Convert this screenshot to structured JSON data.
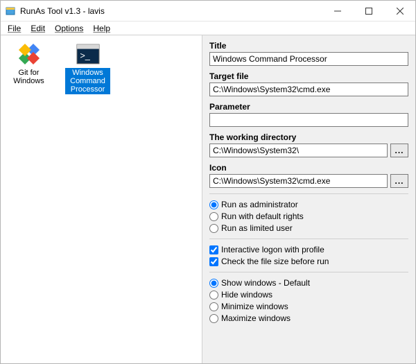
{
  "window": {
    "title": "RunAs Tool v1.3 - lavis"
  },
  "menu": {
    "file": "File",
    "edit": "Edit",
    "options": "Options",
    "help": "Help"
  },
  "icons": {
    "git": "Git for Windows",
    "cmd": "Windows Command Processor"
  },
  "form": {
    "title_label": "Title",
    "title_value": "Windows Command Processor",
    "target_label": "Target file",
    "target_value": "C:\\Windows\\System32\\cmd.exe",
    "parameter_label": "Parameter",
    "parameter_value": "",
    "workdir_label": "The working directory",
    "workdir_value": "C:\\Windows\\System32\\",
    "icon_label": "Icon",
    "icon_value": "C:\\Windows\\System32\\cmd.exe",
    "browse": "..."
  },
  "runmode": {
    "admin": "Run as administrator",
    "default": "Run with default rights",
    "limited": "Run as limited user"
  },
  "checks": {
    "interactive": "Interactive logon with profile",
    "filesize": "Check the file size before run"
  },
  "winmode": {
    "default": "Show windows - Default",
    "hide": "Hide windows",
    "min": "Minimize windows",
    "max": "Maximize windows"
  }
}
